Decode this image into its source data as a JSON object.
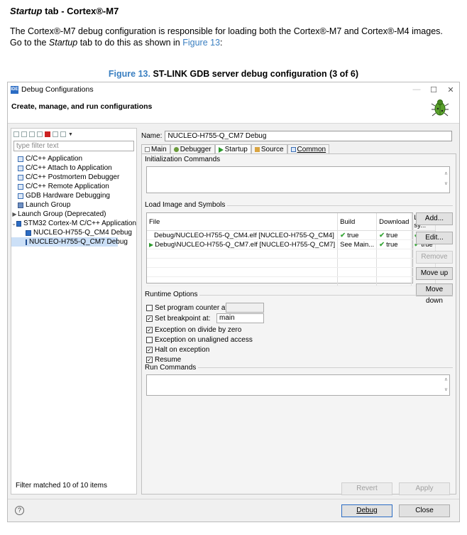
{
  "doc": {
    "heading_italic": "Startup",
    "heading_rest": " tab - Cortex®-M7",
    "para_part1": "The Cortex®-M7 debug configuration is responsible for loading both the Cortex®-M7 and Cortex®-M4 images. Go to the ",
    "para_italic": "Startup",
    "para_part2": " tab to do this as shown in ",
    "para_link": "Figure 13",
    "para_end": ":",
    "fig_label": "Figure 13.",
    "fig_title": " ST-LINK GDB server debug configuration (3 of 6)"
  },
  "window": {
    "icon_text": "IDE",
    "title": "Debug Configurations",
    "minimize": "—",
    "maximize": "☐",
    "close": "✕",
    "header_title": "Create, manage, and run configurations"
  },
  "left": {
    "filter_placeholder": "type filter text",
    "items": [
      {
        "label": "C/C++ Application"
      },
      {
        "label": "C/C++ Attach to Application"
      },
      {
        "label": "C/C++ Postmortem Debugger"
      },
      {
        "label": "C/C++ Remote Application"
      },
      {
        "label": "GDB Hardware Debugging"
      },
      {
        "label": "Launch Group"
      },
      {
        "label": "Launch Group (Deprecated)"
      },
      {
        "label": "STM32 Cortex-M C/C++ Application"
      },
      {
        "label": "NUCLEO-H755-Q_CM4 Debug"
      },
      {
        "label": "NUCLEO-H755-Q_CM7 Debug"
      }
    ],
    "filter_matched": "Filter matched 10 of 10 items"
  },
  "right": {
    "name_label": "Name:",
    "name_value": "NUCLEO-H755-Q_CM7 Debug",
    "tabs": [
      "Main",
      "Debugger",
      "Startup",
      "Source",
      "Common"
    ],
    "init_commands_label": "Initialization Commands",
    "load_image_label": "Load Image and Symbols",
    "table": {
      "headers": [
        "File",
        "Build",
        "Download",
        "Load sy..."
      ],
      "rows": [
        {
          "file": "Debug/NUCLEO-H755-Q_CM4.elf [NUCLEO-H755-Q_CM4]",
          "build": "true",
          "download": "true",
          "load": "true"
        },
        {
          "file": "Debug\\NUCLEO-H755-Q_CM7.elf [NUCLEO-H755-Q_CM7]",
          "build": "See Main...",
          "download": "true",
          "load": "true"
        }
      ]
    },
    "buttons": {
      "add": "Add...",
      "edit": "Edit...",
      "remove": "Remove",
      "move_up": "Move up",
      "move_down": "Move down"
    },
    "runtime_label": "Runtime Options",
    "options": {
      "set_pc": "Set program counter at (hex):",
      "set_bp": "Set breakpoint at:",
      "bp_value": "main",
      "exc_div": "Exception on divide by zero",
      "exc_unaligned": "Exception on unaligned access",
      "halt": "Halt on exception",
      "resume": "Resume"
    },
    "run_commands_label": "Run Commands",
    "revert": "Revert",
    "apply": "Apply"
  },
  "footer": {
    "help": "?",
    "debug": "Debug",
    "close": "Close"
  }
}
